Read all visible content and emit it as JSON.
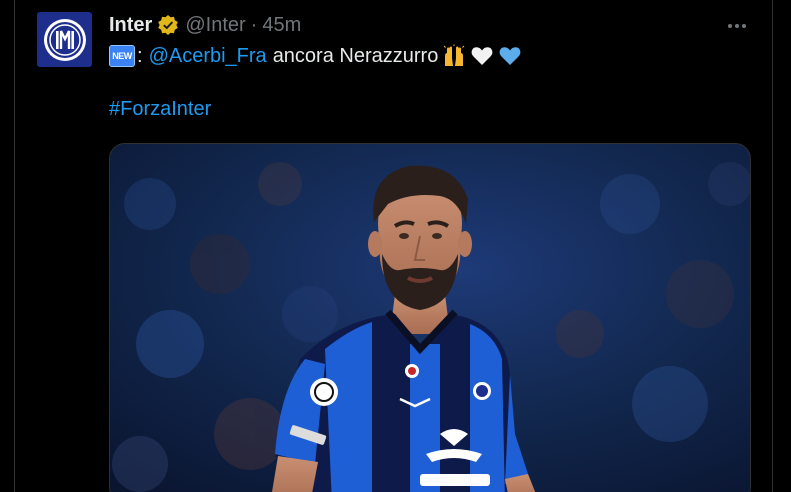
{
  "tweet": {
    "display_name": "Inter",
    "handle": "@Inter",
    "separator": "·",
    "time": "45m",
    "badge": "NEW",
    "colon": ":",
    "mention": "@Acerbi_Fra",
    "text": "ancora Nerazzurro",
    "emojis": [
      "raising-hands-icon",
      "white-heart-icon",
      "blue-heart-icon"
    ],
    "hashtag": "#ForzaInter",
    "more_icon": "more-options-icon",
    "verified_icon": "verified-gold-badge-icon"
  },
  "colors": {
    "background": "#000000",
    "link": "#1d9bf0",
    "secondary": "#71767b",
    "inter_blue": "#1d2e8c",
    "verified_gold": "#e2b719"
  }
}
